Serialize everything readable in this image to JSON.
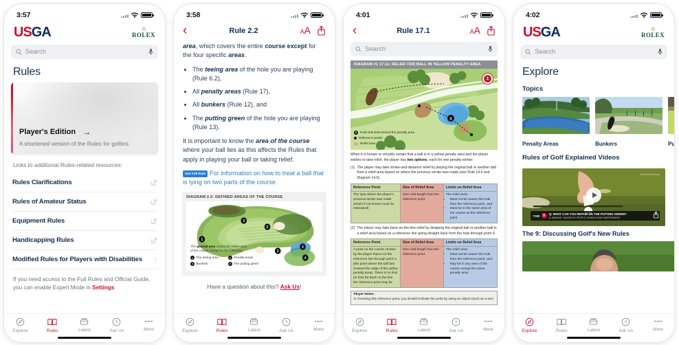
{
  "brand": {
    "logo_us": "US",
    "logo_ga": "GA",
    "rolex_crown": "♔",
    "rolex_word": "ROLEX"
  },
  "screens": [
    {
      "id": "rules-home",
      "status": {
        "time": "3:57",
        "wifi": "wifi-icon",
        "battery": "battery-icon"
      },
      "search": {
        "placeholder": "Search",
        "icon": "search-icon",
        "mic": "microphone-icon"
      },
      "page_title": "Rules",
      "card": {
        "title": "Player's Edition",
        "arrow": "→",
        "subtitle": "A shortened version of the Rules for golfers"
      },
      "links_intro": "Links to additional Rules-related resources:",
      "links": [
        {
          "label": "Rules Clarifications",
          "affordance": "external-link-icon"
        },
        {
          "label": "Rules of Amateur Status",
          "affordance": "external-link-icon"
        },
        {
          "label": "Equipment Rules",
          "affordance": "external-link-icon"
        },
        {
          "label": "Handicapping Rules",
          "affordance": "external-link-icon"
        },
        {
          "label": "Modified Rules for Players with Disabilities",
          "affordance": "chevron-right-icon"
        }
      ],
      "footnote_a": "If you need access to the Full Rules and Official Guide,",
      "footnote_b": "you can enable Expert Mode in ",
      "footnote_link": "Settings",
      "tabs": [
        {
          "label": "Explore",
          "icon": "compass-icon",
          "active": false
        },
        {
          "label": "Rules",
          "icon": "open-book-icon",
          "active": true
        },
        {
          "label": "Latest",
          "icon": "news-stack-icon",
          "active": false
        },
        {
          "label": "Ask Us",
          "icon": "question-circle-icon",
          "active": false
        },
        {
          "label": "More",
          "icon": "ellipsis-icon",
          "active": false
        }
      ]
    },
    {
      "id": "rule-2-2",
      "status": {
        "time": "3:58"
      },
      "nav": {
        "back": "‹",
        "title": "Rule 2.2",
        "text_size": "AA",
        "share": "share-icon"
      },
      "paragraph_1_a": "area",
      "paragraph_1_b": ", which covers the entire ",
      "paragraph_1_c": "course except",
      "paragraph_1_d": " for the four specific ",
      "paragraph_1_e": "areas",
      "paragraph_1_f": ".",
      "bullets": [
        {
          "pre": "The ",
          "em": "teeing area",
          "post": " of the hole you are playing (Rule 6.2),"
        },
        {
          "pre": "All ",
          "em": "penalty areas",
          "post": " (Rule 17),"
        },
        {
          "pre": "All ",
          "em": "bunkers",
          "post": " (Rule 12), and"
        },
        {
          "pre": "The ",
          "em": "putting green",
          "post": " of the hole you are playing (Rule 13)."
        }
      ],
      "paragraph_2_a": "It is important to know the ",
      "paragraph_2_em": "area of the course",
      "paragraph_2_b": " where your ball lies as this affects the Rules that apply in playing your ball or taking relief.",
      "note_badge": "See Full Rule",
      "note_text": "For information on how to treat a ball that is lying on two parts of the course.",
      "diagram": {
        "title": "DIAGRAM 2.2:  DEFINED AREAS OF THE COURSE",
        "caption_a": "The ",
        "caption_b": "general area",
        "caption_c": " covers the entire area",
        "caption_d": "of the course except for the following:",
        "legend": [
          {
            "num": "1",
            "label": "The teeing area"
          },
          {
            "num": "2",
            "label": "Bunkers"
          },
          {
            "num": "3",
            "label": "Penalty areas"
          },
          {
            "num": "4",
            "label": "The putting green"
          }
        ]
      },
      "ask_prefix": "Have a question about this? ",
      "ask_link": "Ask Us",
      "ask_suffix": "!",
      "tabs": [
        {
          "label": "Explore",
          "active": false
        },
        {
          "label": "Rules",
          "active": true
        },
        {
          "label": "Latest",
          "active": false
        },
        {
          "label": "Ask Us",
          "active": false
        },
        {
          "label": "More",
          "active": false
        }
      ]
    },
    {
      "id": "rule-17-1",
      "status": {
        "time": "4:01"
      },
      "nav": {
        "back": "‹",
        "title": "Rule 17.1",
        "text_size": "AA",
        "share": "share-icon"
      },
      "search": {
        "placeholder": "Search",
        "icon": "search-icon",
        "mic": "microphone-icon"
      },
      "diagram": {
        "title": "DIAGRAM #1 17.1e:  RELIEF FOR BALL IN YELLOW PENALTY AREA",
        "seal_label": "1",
        "legend": [
          {
            "marker": "X",
            "label": "Point that ball entered the penalty area"
          },
          {
            "marker": "dot",
            "label": "Reference points"
          },
          {
            "marker": "swatch",
            "label": "Relief area"
          }
        ]
      },
      "intro_a": "When it is known or virtually certain that a ball is in a yellow penalty area and the player wishes to take relief, the player has ",
      "intro_b": "two options",
      "intro_c": ", each for one penalty stroke:",
      "option_1_num": "(1)",
      "option_1_text": "The player may take stroke-and-distance relief by playing the original ball or another ball from a relief area based on where the previous stroke was made (see Rule 14.6 and Diagram 14.6).",
      "table_1": {
        "headers": [
          "Reference Point",
          "Size of Relief Area",
          "Limits on Relief Area"
        ],
        "col1": "The spot where the player's previous stroke was made (which if not known must be estimated)",
        "col2": "One club-length from the reference point",
        "col3_intro": "The relief area:",
        "col3_bullets": [
          "Must not be nearer the hole than the reference point, and",
          "Must be in the same area of the course as the reference point"
        ]
      },
      "option_2_num": "(2)",
      "option_2_text": "The player may take back-on-the-line relief by dropping the original ball or another ball in a relief area based on a reference line going straight back from the hole through point X.",
      "table_2": {
        "headers": [
          "Reference Point",
          "Size of Relief Area",
          "Limits on Relief Area"
        ],
        "col1": "A point on the course chosen by the player that is on the reference line through point X (the point where the ball last crossed the edge of the yellow penalty area). There is no limit on how far back on the line the reference point may be",
        "col2": "One club-length from the reference point",
        "col3_intro": "The relief area:",
        "col3_bullets": [
          "Must not be nearer the hole than the reference point, and",
          "May be in any area of the course except the same penalty area"
        ]
      },
      "player_notes_title": "Player Notes:",
      "player_notes_text": "In choosing this reference point, you should indicate the point by using an object (such as a tee).",
      "tabs": [
        {
          "label": "Explore",
          "active": false
        },
        {
          "label": "Rules",
          "active": true
        },
        {
          "label": "Latest",
          "active": false
        },
        {
          "label": "Ask Us",
          "active": false
        },
        {
          "label": "More",
          "active": false
        }
      ]
    },
    {
      "id": "explore",
      "status": {
        "time": "4:02"
      },
      "search": {
        "placeholder": "Search",
        "icon": "search-icon",
        "mic": "microphone-icon"
      },
      "page_title": "Explore",
      "topics_head": "Topics",
      "topics": [
        {
          "label": "Penalty Areas",
          "thumb": "penalty-area-photo"
        },
        {
          "label": "Bunkers",
          "thumb": "bunker-photo"
        },
        {
          "label": "Putting",
          "thumb": "putting-photo"
        }
      ],
      "videos_head": "Rules of Golf Explained Videos",
      "video": {
        "the9_label": "THE",
        "the9_num": "9",
        "question": "Q: WHAT CAN YOU REPAIR ON THE PUTTING GREEN?",
        "answer": "A: DAMAGE CAUSED BY PEOPLE, ANIMALS AND MAINTENANCE",
        "watermark": "#RulesRoundup",
        "play": "play-icon",
        "share": "share-icon",
        "caption": "The 9: Discussing Golf's New Rules"
      },
      "tabs": [
        {
          "label": "Explore",
          "active": true
        },
        {
          "label": "Rules",
          "active": false
        },
        {
          "label": "Latest",
          "active": false
        },
        {
          "label": "Ask Us",
          "active": false
        },
        {
          "label": "More",
          "active": false
        }
      ]
    }
  ],
  "colors": {
    "brand_red": "#c8102e",
    "brand_navy": "#0b2d5b",
    "rolex_green": "#12523d"
  }
}
